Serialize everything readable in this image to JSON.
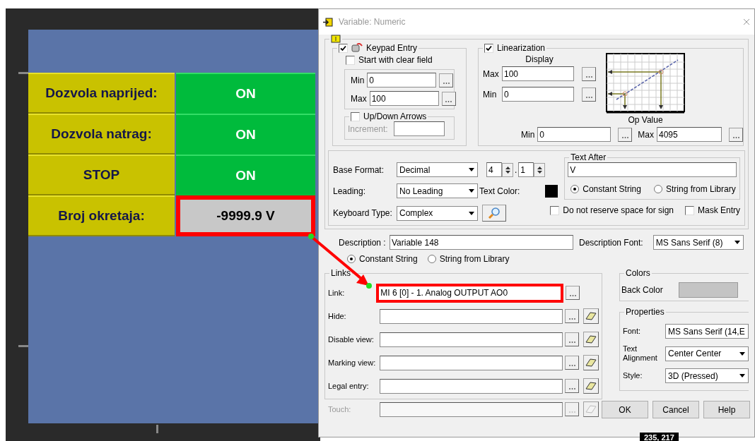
{
  "hmi": {
    "rows": [
      {
        "label": "Dozvola naprijed:",
        "value": "ON",
        "kind": "status",
        "highlighted": false
      },
      {
        "label": "Dozvola natrag:",
        "value": "ON",
        "kind": "status",
        "highlighted": false
      },
      {
        "label": "STOP",
        "value": "ON",
        "kind": "status",
        "highlighted": false
      },
      {
        "label": "Broj okretaja:",
        "value": "-9999.9 V",
        "kind": "numeric",
        "highlighted": true
      }
    ]
  },
  "dialog": {
    "title": "Variable: Numeric",
    "keypad": {
      "label": "Keypad Entry",
      "checked": true,
      "clear_field": {
        "label": "Start with clear field",
        "checked": false
      },
      "min": {
        "label": "Min",
        "value": "0"
      },
      "max": {
        "label": "Max",
        "value": "100"
      },
      "arrows": {
        "label": "Up/Down Arrows",
        "checked": false
      },
      "increment_label": "Increment:"
    },
    "linearization": {
      "label": "Linearization",
      "checked": true,
      "display_label": "Display",
      "display_max": {
        "label": "Max",
        "value": "100"
      },
      "display_min": {
        "label": "Min",
        "value": "0"
      },
      "op_label": "Op Value",
      "op_min": {
        "label": "Min",
        "value": "0"
      },
      "op_max": {
        "label": "Max",
        "value": "4095"
      }
    },
    "format": {
      "base_format": {
        "label": "Base Format:",
        "value": "Decimal"
      },
      "digits": "4",
      "separator": ".",
      "decimals": "1",
      "leading": {
        "label": "Leading:",
        "value": "No Leading"
      },
      "text_color_label": "Text Color:",
      "keyboard_type": {
        "label": "Keyboard Type:",
        "value": "Complex"
      },
      "text_after": {
        "title": "Text After",
        "value": "V",
        "options": [
          {
            "label": "Constant String",
            "selected": true
          },
          {
            "label": "String from Library",
            "selected": false
          }
        ]
      },
      "no_sign_space": {
        "label": "Do not reserve space for sign",
        "checked": false
      },
      "mask_entry": {
        "label": "Mask Entry",
        "checked": false
      }
    },
    "description": {
      "label": "Description :",
      "value": "Variable 148",
      "font_label": "Description Font:",
      "font": "MS Sans Serif (8)",
      "options": [
        {
          "label": "Constant String",
          "selected": true
        },
        {
          "label": "String from Library",
          "selected": false
        }
      ]
    },
    "links": {
      "title": "Links",
      "rows": [
        {
          "label": "Link:",
          "value": "MI 6 [0] - 1. Analog OUTPUT AO0",
          "disabled": false,
          "clearable": false,
          "highlighted": true
        },
        {
          "label": "Hide:",
          "disabled": false,
          "clearable": true,
          "highlighted": false
        },
        {
          "label": "Disable view:",
          "disabled": false,
          "clearable": true,
          "highlighted": false
        },
        {
          "label": "Marking view:",
          "disabled": false,
          "clearable": true,
          "highlighted": false
        },
        {
          "label": "Legal entry:",
          "disabled": false,
          "clearable": true,
          "highlighted": false
        },
        {
          "label": "Touch:",
          "disabled": true,
          "clearable": true,
          "highlighted": false
        }
      ]
    },
    "colors": {
      "title": "Colors",
      "back_color_label": "Back Color"
    },
    "properties": {
      "title": "Properties",
      "rows": [
        {
          "label": "Font:",
          "value": "MS Sans Serif (14,E"
        },
        {
          "label": "Text Alignment",
          "value": "Center Center"
        },
        {
          "label": "Style:",
          "value": "3D (Pressed)"
        }
      ]
    },
    "buttons": [
      "OK",
      "Cancel",
      "Help"
    ]
  },
  "cursor_coordinates": "235, 217"
}
